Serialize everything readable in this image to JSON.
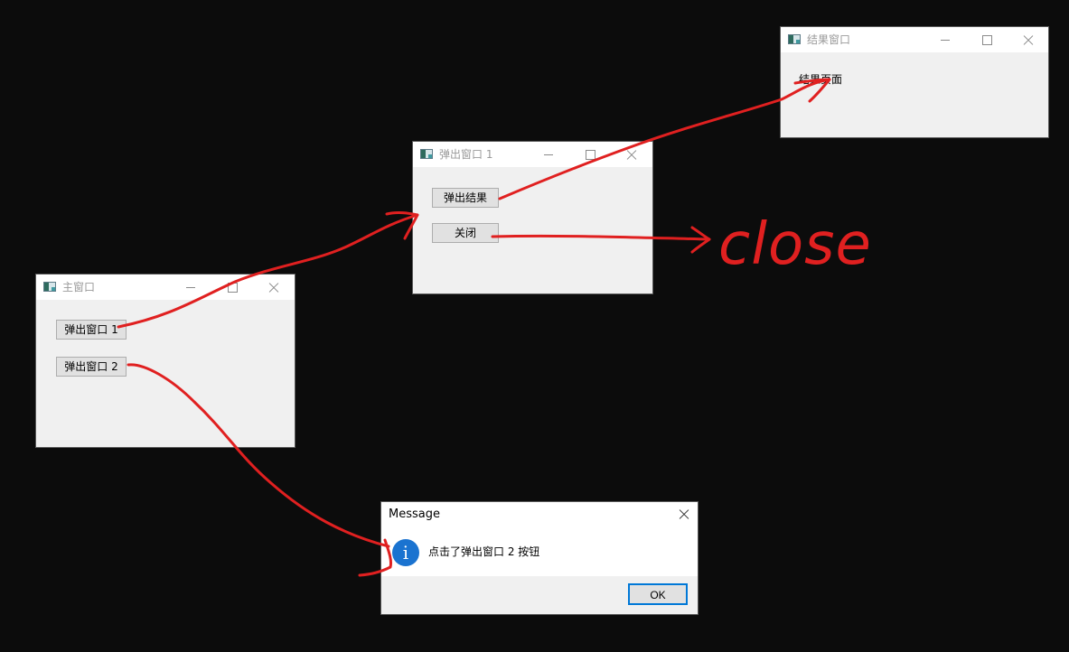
{
  "main_window": {
    "title": "主窗口",
    "buttons": {
      "popup1": "弹出窗口 1",
      "popup2": "弹出窗口 2"
    }
  },
  "popup_window_1": {
    "title": "弹出窗口 1",
    "buttons": {
      "show_result": "弹出结果",
      "close": "关闭"
    }
  },
  "result_window": {
    "title": "结果窗口",
    "label": "结果页面"
  },
  "message_box": {
    "title": "Message",
    "icon": "info-icon",
    "text": "点击了弹出窗口 2 按钮",
    "ok": "OK"
  },
  "annotation": {
    "text": "close",
    "color": "#e02020"
  },
  "colors": {
    "background": "#0c0c0c",
    "window_body": "#f0f0f0",
    "ok_focus": "#0078d7",
    "info_blue": "#1a73d0"
  }
}
